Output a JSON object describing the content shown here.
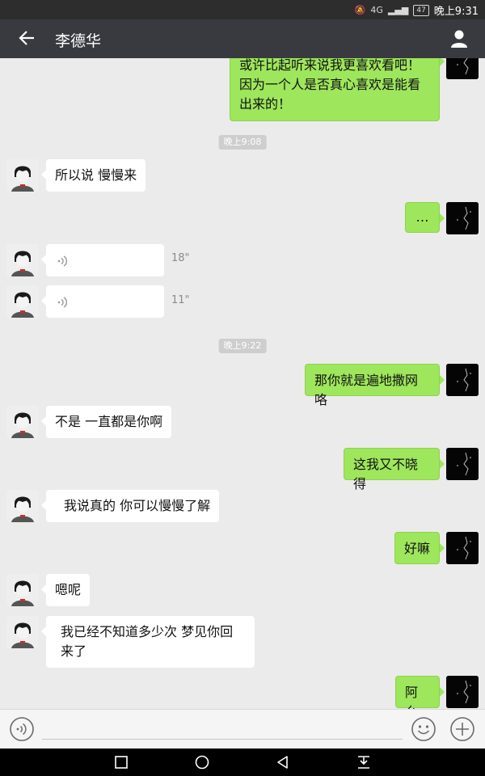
{
  "status_bar": {
    "time": "晚上9:31",
    "network": "4G",
    "battery": "47"
  },
  "header": {
    "title": "李德华"
  },
  "messages": {
    "m0": "或许比起听来说我更喜欢看吧！因为一个人是否真心喜欢是能看出来的！",
    "t1": "晚上9:08",
    "m1": "所以说 慢慢来",
    "m2": "…",
    "v1": "18\"",
    "v2": "11\"",
    "t2": "晚上9:22",
    "m3": "那你就是遍地撒网咯",
    "m4": "不是 一直都是你啊",
    "m5": "这我又不晓得",
    "m6": "我说真的 你可以慢慢了解",
    "m7": "好嘛",
    "m8": "嗯呢",
    "m9": "我已经不知道多少次 梦见你回来了",
    "m10": "阿么"
  },
  "colors": {
    "outgoing_bubble": "#9ee65c",
    "incoming_bubble": "#ffffff",
    "title_bar": "#393a3f"
  }
}
